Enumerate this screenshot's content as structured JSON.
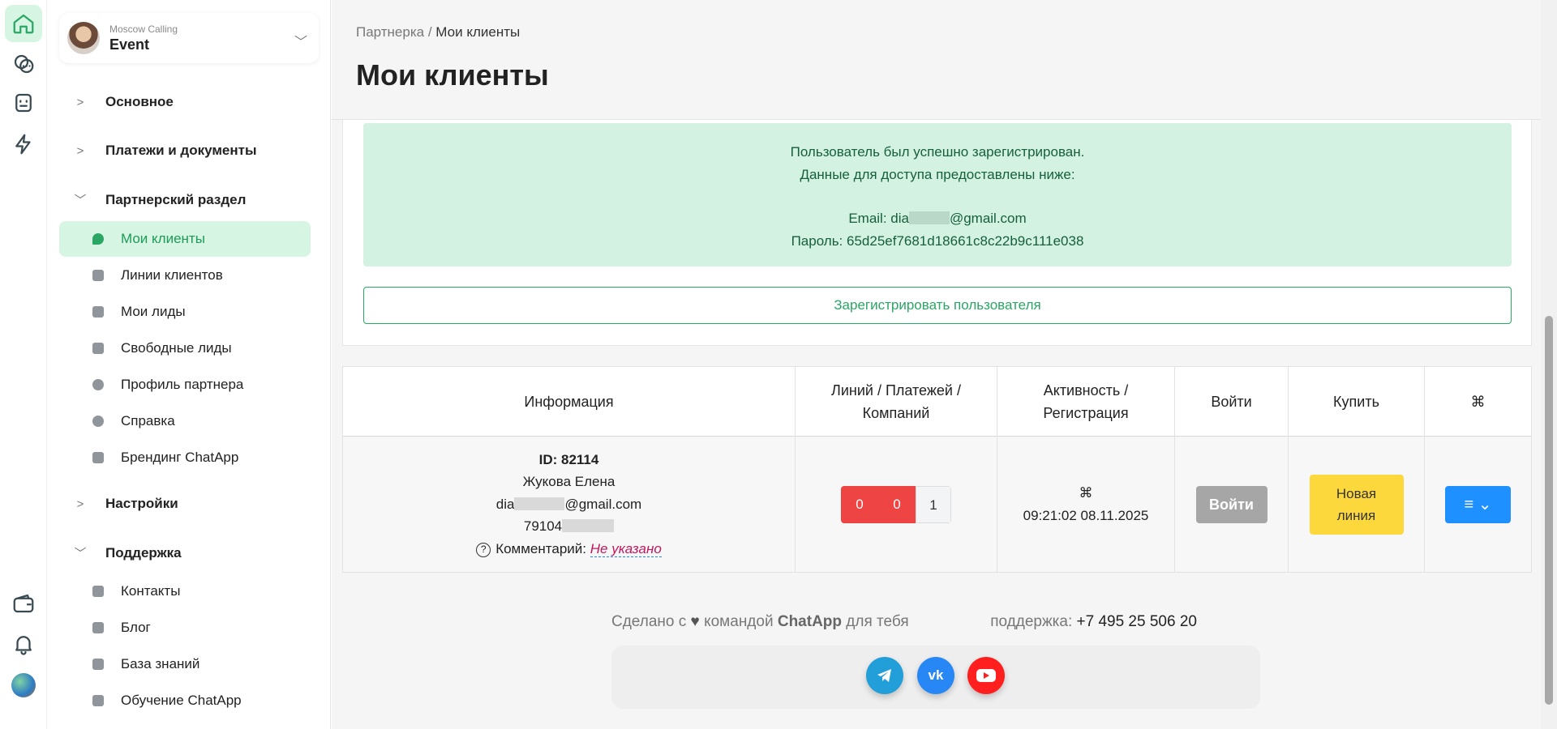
{
  "account": {
    "org": "Moscow Calling",
    "name": "Event"
  },
  "menu": {
    "sections": [
      {
        "label": "Основное"
      },
      {
        "label": "Платежи и документы"
      },
      {
        "label": "Партнерский раздел"
      },
      {
        "label": "Настройки"
      },
      {
        "label": "Поддержка"
      }
    ],
    "partner_items": [
      {
        "label": "Мои клиенты",
        "icon": "bird-icon",
        "active": true
      },
      {
        "label": "Линии клиентов",
        "icon": "list-icon"
      },
      {
        "label": "Мои лиды",
        "icon": "inbox-icon"
      },
      {
        "label": "Свободные лиды",
        "icon": "cart-icon"
      },
      {
        "label": "Профиль партнера",
        "icon": "user-icon"
      },
      {
        "label": "Справка",
        "icon": "info-icon"
      },
      {
        "label": "Брендинг ChatApp",
        "icon": "stamp-icon"
      }
    ],
    "support_items": [
      {
        "label": "Контакты",
        "icon": "headphones-icon"
      },
      {
        "label": "Блог",
        "icon": "camera-icon"
      },
      {
        "label": "База знаний",
        "icon": "bookmark-icon"
      },
      {
        "label": "Обучение ChatApp",
        "icon": "graduation-cap-icon"
      }
    ]
  },
  "header": {
    "crumb_parent": "Партнерка /",
    "crumb_current": "Мои клиенты",
    "title": "Мои клиенты"
  },
  "alert": {
    "line1": "Пользователь был успешно зарегистрирован.",
    "line2": "Данные для доступа предоставлены ниже:",
    "email_label": "Email: dia",
    "email_domain": "@gmail.com",
    "password": "Пароль: 65d25ef7681d18661c8c22b9c111e038"
  },
  "register_button": "Зарегистрировать пользователя",
  "table": {
    "headers": [
      "Информация",
      "Линий / Платежей / Компаний",
      "Активность / Регистрация",
      "Войти",
      "Купить",
      "⌘"
    ],
    "row": {
      "id": "ID: 82114",
      "name": "Жукова Елена",
      "email_prefix": "dia",
      "email_domain": "@gmail.com",
      "phone_prefix": "79104",
      "comment_label": "Комментарий:",
      "comment_value": "Не указано",
      "lines": "0",
      "payments": "0",
      "companies": "1",
      "activity_icon": "⌘",
      "registered": "09:21:02 08.11.2025",
      "login_button": "Войти",
      "buy_button": "Новая линия",
      "actions_button": "≡ ⌄"
    }
  },
  "footer": {
    "made_prefix": "Сделано с",
    "made_middle": "командой",
    "brand": "ChatApp",
    "made_suffix": "для тебя",
    "support_label": "поддержка:",
    "phone": "+7 495 25 506 20"
  },
  "colors": {
    "accent": "#2aa665",
    "danger": "#ef4444",
    "warning": "#fdd83d",
    "primary": "#1e90ff"
  }
}
